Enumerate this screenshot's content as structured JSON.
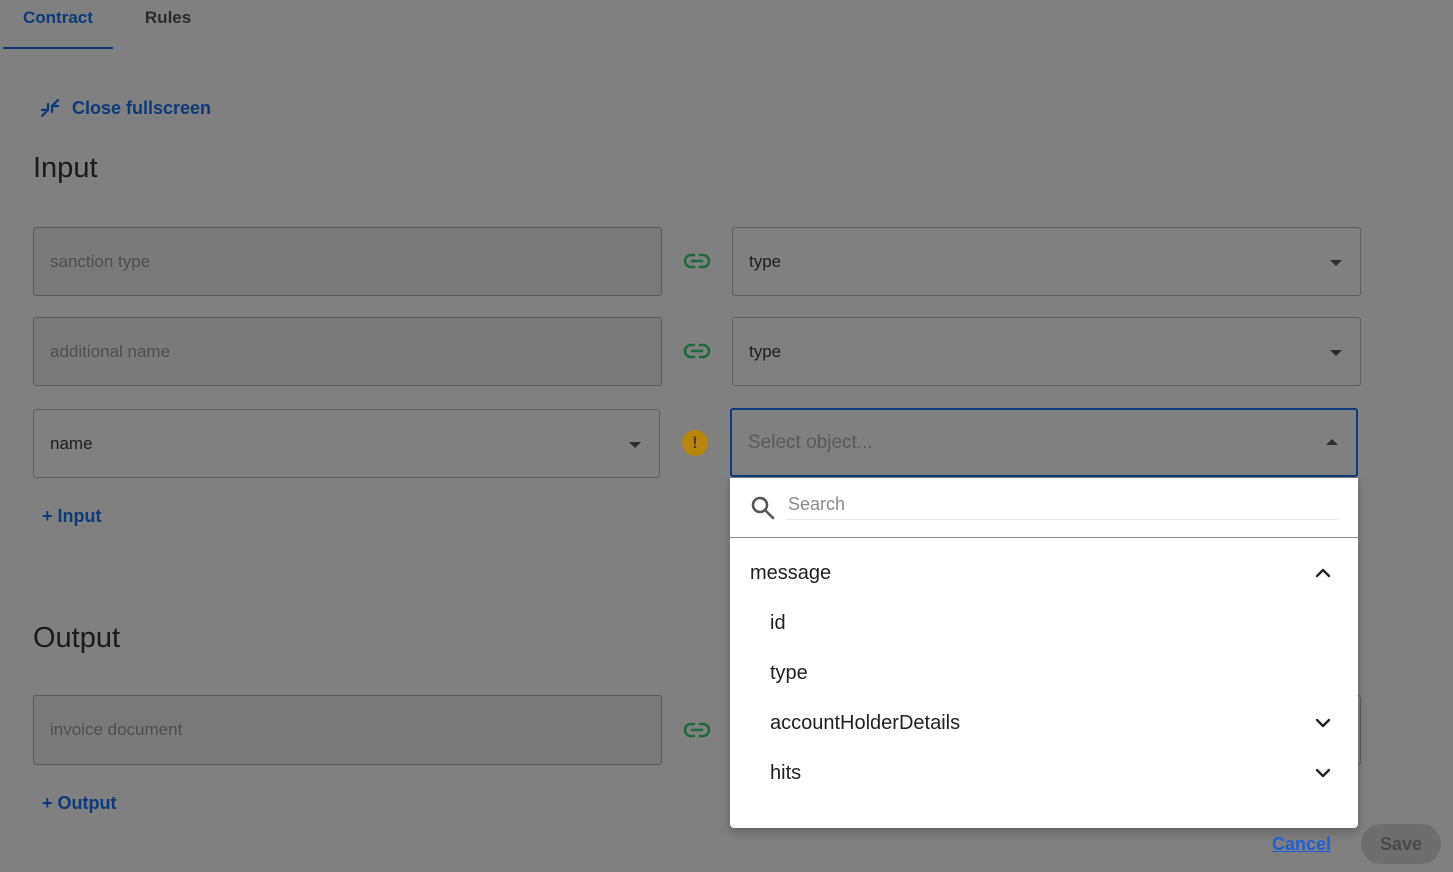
{
  "tabs": [
    {
      "label": "Contract",
      "active": true
    },
    {
      "label": "Rules",
      "active": false
    }
  ],
  "close_fullscreen": {
    "label": "Close fullscreen",
    "icon": "collapse-icon"
  },
  "input_section": {
    "title": "Input",
    "rows": [
      {
        "source_value": "sanction type",
        "status_icon": "link-icon",
        "target_value": "type"
      },
      {
        "source_value": "additional name",
        "status_icon": "link-icon",
        "target_value": "type"
      },
      {
        "source_value": "name",
        "status_icon": "warning-icon",
        "warning_glyph": "!",
        "target_placeholder": "Select object..."
      }
    ],
    "add_label": "+ Input"
  },
  "output_section": {
    "title": "Output",
    "rows": [
      {
        "source_value": "invoice document",
        "status_icon": "link-icon"
      }
    ],
    "add_label": "+ Output"
  },
  "dropdown": {
    "search_placeholder": "Search",
    "items": [
      {
        "label": "message",
        "expanded": true,
        "expandable": true
      },
      {
        "label": "id",
        "expandable": false
      },
      {
        "label": "type",
        "expandable": false
      },
      {
        "label": "accountHolderDetails",
        "expandable": true,
        "expanded": false
      },
      {
        "label": "hits",
        "expandable": true,
        "expanded": false
      }
    ]
  },
  "footer": {
    "cancel_label": "Cancel",
    "save_label": "Save"
  },
  "colors": {
    "primary": "#0d3a7a",
    "link_green": "#1e6b3a",
    "warning": "#b7860b",
    "overlay": "#808080"
  }
}
